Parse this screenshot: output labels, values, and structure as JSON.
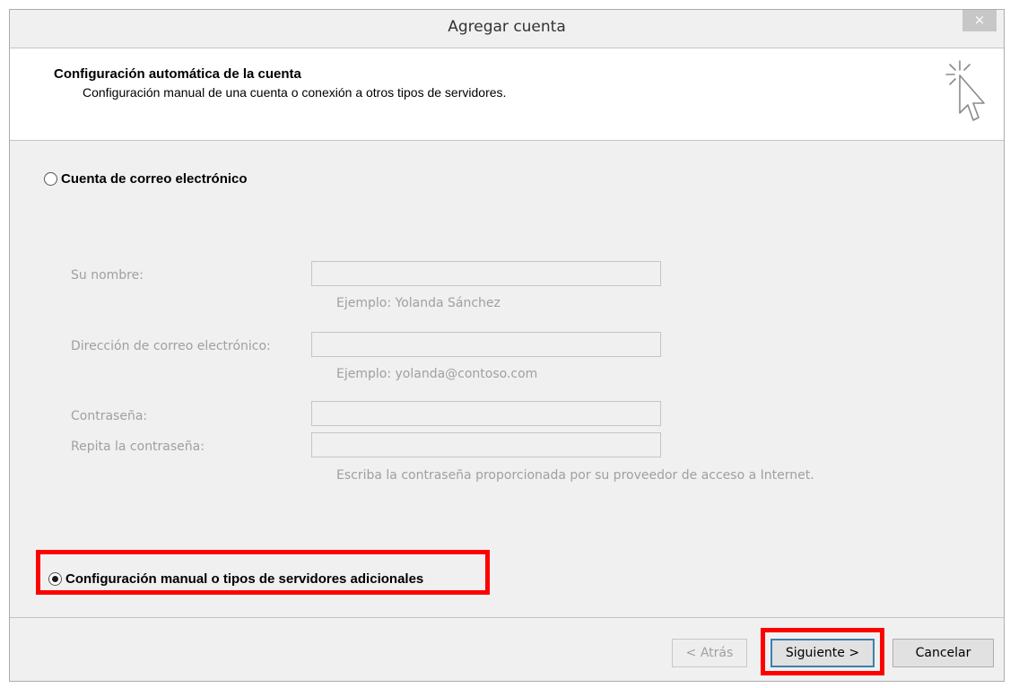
{
  "window": {
    "title": "Agregar cuenta",
    "close_glyph": "×"
  },
  "header": {
    "title": "Configuración automática de la cuenta",
    "subtitle": "Configuración manual de una cuenta o conexión a otros tipos de servidores.",
    "icon": "cursor-click-icon"
  },
  "options": {
    "email_account": {
      "label": "Cuenta de correo electrónico",
      "selected": false
    },
    "manual_setup": {
      "label": "Configuración manual o tipos de servidores adicionales",
      "selected": true
    }
  },
  "form": {
    "name": {
      "label": "Su nombre:",
      "value": "",
      "hint": "Ejemplo: Yolanda Sánchez"
    },
    "email": {
      "label": "Dirección de correo electrónico:",
      "value": "",
      "hint": "Ejemplo: yolanda@contoso.com"
    },
    "password": {
      "label": "Contraseña:",
      "value": ""
    },
    "password_repeat": {
      "label": "Repita la contraseña:",
      "value": "",
      "hint": "Escriba la contraseña proporcionada por su proveedor de acceso a Internet."
    },
    "disabled": true
  },
  "buttons": {
    "back": "< Atrás",
    "next": "Siguiente >",
    "cancel": "Cancelar"
  },
  "colors": {
    "highlight": "#ff0000",
    "disabled_text": "#a0a0a0",
    "dialog_bg": "#f0f0f0"
  }
}
